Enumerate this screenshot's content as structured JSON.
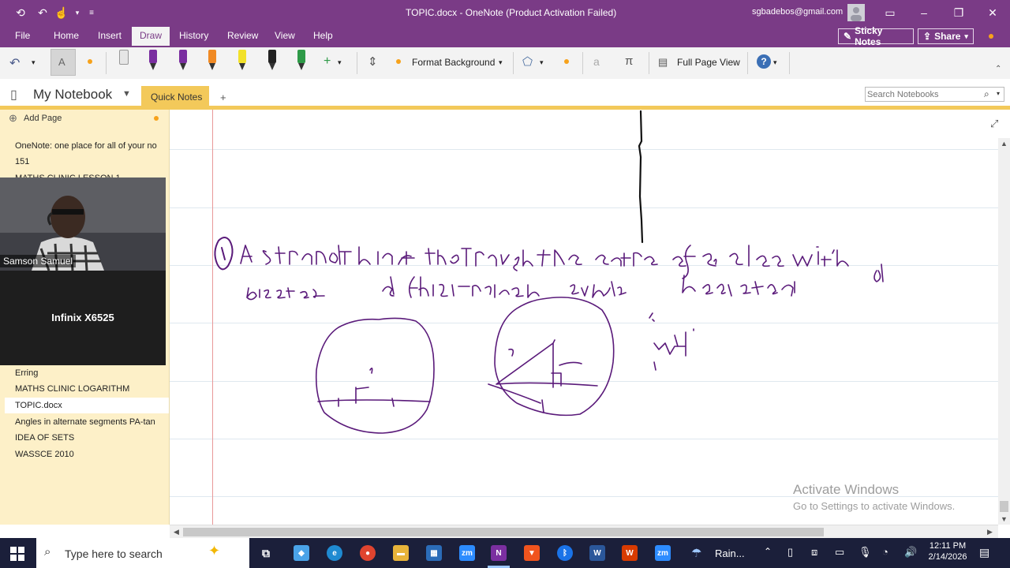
{
  "window": {
    "title": "TOPIC.docx  -  OneNote (Product Activation Failed)",
    "user_email": "sgbadebos@gmail.com"
  },
  "ribbon_tabs": [
    "File",
    "Home",
    "Insert",
    "Draw",
    "History",
    "Review",
    "View",
    "Help"
  ],
  "active_tab": "Draw",
  "ribbon_right": {
    "sticky_notes": "Sticky Notes",
    "share": "Share"
  },
  "draw_toolbar": {
    "text_mode": "A",
    "format_background": "Format Background",
    "full_page_view": "Full Page View",
    "pen_colors": [
      "#e6e6e6",
      "#7a2ea0",
      "#7a2ea0",
      "#f08a24",
      "#f2e12a",
      "#222222",
      "#2e9a48"
    ]
  },
  "notebook": {
    "name": "My Notebook",
    "section_tab": "Quick Notes",
    "add_section": "+",
    "search_placeholder": "Search Notebooks"
  },
  "pages_pane": {
    "add_page": "Add Page",
    "pages": [
      "OneNote: one place for all of your no",
      "151",
      "MATHS CLINIC LESSON 1",
      "Erring",
      "MATHS CLINIC LOGARITHM",
      "TOPIC.docx",
      "Angles in alternate segments PA-tan",
      "IDEA OF SETS",
      "WASSCE 2010"
    ],
    "selected": "TOPIC.docx"
  },
  "video_tiles": [
    {
      "label": "Samson Samuel"
    },
    {
      "label": "Infinix X6525"
    }
  ],
  "watermark": {
    "title": "Activate Windows",
    "subtitle": "Go to Settings to activate Windows."
  },
  "taskbar": {
    "search_placeholder": "Type here to search",
    "weather": "Rain...",
    "time": "12:11 PM",
    "date": "2/14/2026"
  },
  "colors": {
    "onenote_purple": "#7a3b86",
    "page_list_bg": "#fdf0c8",
    "section_gold": "#f3c95a",
    "ink": "#5a1a7a"
  }
}
